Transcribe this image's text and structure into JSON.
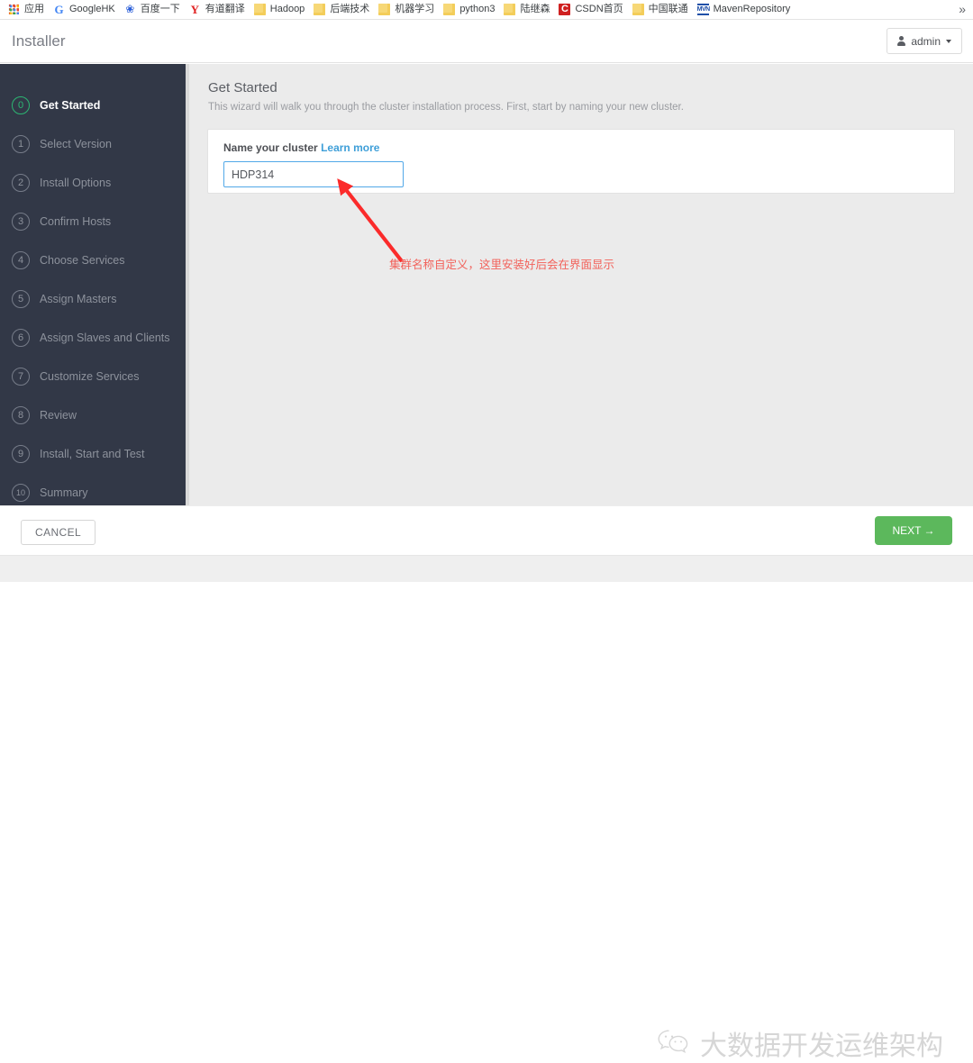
{
  "browser": {
    "bookmarks": [
      {
        "label": "应用",
        "icon": "apps-grid-icon"
      },
      {
        "label": "GoogleHK",
        "icon": "google-icon",
        "glyph": "G"
      },
      {
        "label": "百度一下",
        "icon": "baidu-icon",
        "glyph": "❀"
      },
      {
        "label": "有道翻译",
        "icon": "youdao-icon",
        "glyph": "Y"
      },
      {
        "label": "Hadoop",
        "icon": "folder-icon"
      },
      {
        "label": "后端技术",
        "icon": "folder-icon"
      },
      {
        "label": "机器学习",
        "icon": "folder-icon"
      },
      {
        "label": "python3",
        "icon": "folder-icon"
      },
      {
        "label": "陆继森",
        "icon": "folder-icon"
      },
      {
        "label": "CSDN首页",
        "icon": "csdn-icon",
        "glyph": "C"
      },
      {
        "label": "中国联通",
        "icon": "folder-icon"
      },
      {
        "label": "MavenRepository",
        "icon": "maven-icon",
        "glyph": "MVN"
      }
    ],
    "overflow_label": "»"
  },
  "header": {
    "title": "Installer",
    "user_label": "admin"
  },
  "sidebar": {
    "steps": [
      {
        "number": "0",
        "label": "Get Started"
      },
      {
        "number": "1",
        "label": "Select Version"
      },
      {
        "number": "2",
        "label": "Install Options"
      },
      {
        "number": "3",
        "label": "Confirm Hosts"
      },
      {
        "number": "4",
        "label": "Choose Services"
      },
      {
        "number": "5",
        "label": "Assign Masters"
      },
      {
        "number": "6",
        "label": "Assign Slaves and Clients"
      },
      {
        "number": "7",
        "label": "Customize Services"
      },
      {
        "number": "8",
        "label": "Review"
      },
      {
        "number": "9",
        "label": "Install, Start and Test"
      },
      {
        "number": "10",
        "label": "Summary"
      }
    ],
    "active_index": 0
  },
  "main": {
    "heading": "Get Started",
    "subheading": "This wizard will walk you through the cluster installation process. First, start by naming your new cluster.",
    "panel": {
      "label": "Name your cluster",
      "learn_more": "Learn more",
      "input_value": "HDP314",
      "input_placeholder": ""
    },
    "annotation": {
      "text": "集群名称自定义，这里安装好后会在界面显示",
      "color": "#f2615a"
    }
  },
  "footer": {
    "cancel_label": "CANCEL",
    "next_label": "NEXT →"
  },
  "watermark": {
    "logo": "wechat-icon",
    "text": "大数据开发运维架构"
  },
  "colors": {
    "sidebar_bg": "#323847",
    "active_step": "#2cb673",
    "content_bg": "#ebebeb",
    "link": "#3f9fd8",
    "input_focus_border": "#52a8e8",
    "primary_button": "#5cb85c",
    "annotation_red": "#f2615a"
  }
}
